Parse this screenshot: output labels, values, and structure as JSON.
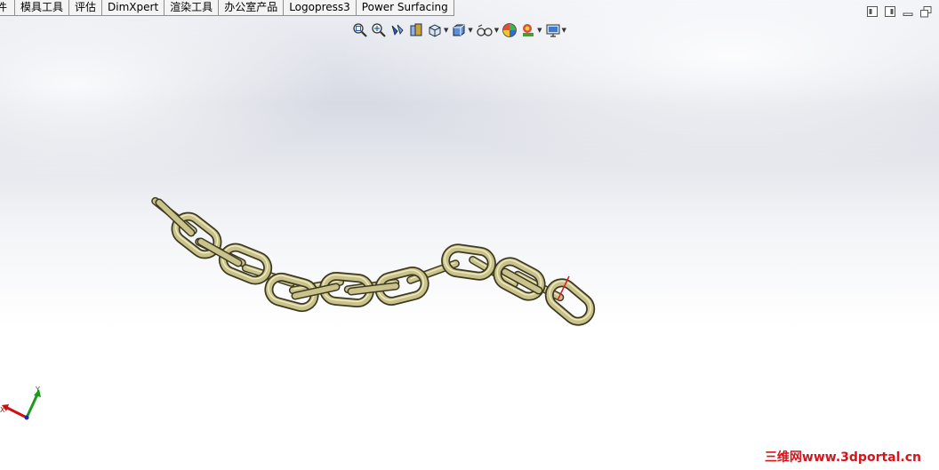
{
  "tabs": [
    "件",
    "模具工具",
    "评估",
    "DimXpert",
    "渲染工具",
    "办公室产品",
    "Logopress3",
    "Power Surfacing"
  ],
  "toolbar": {
    "icons": [
      "zoom-to-fit-icon",
      "zoom-area-icon",
      "previous-view-icon",
      "section-view-icon",
      "view-orientation-icon",
      "display-style-icon",
      "hide-show-items-icon",
      "edit-appearance-icon",
      "apply-scene-icon",
      "view-settings-icon"
    ]
  },
  "window_controls": [
    "tile-left-icon",
    "tile-right-icon",
    "minimize-icon",
    "restore-icon"
  ],
  "triad": {
    "x_label": "X",
    "y_label": "Y"
  },
  "watermark": "三维网www.3dportal.cn",
  "colors": {
    "chain": "#c9c28a",
    "chain_dark": "#4a4528",
    "axis_x": "#d01010",
    "axis_y": "#1a9a1a",
    "axis_z": "#2020c0"
  }
}
